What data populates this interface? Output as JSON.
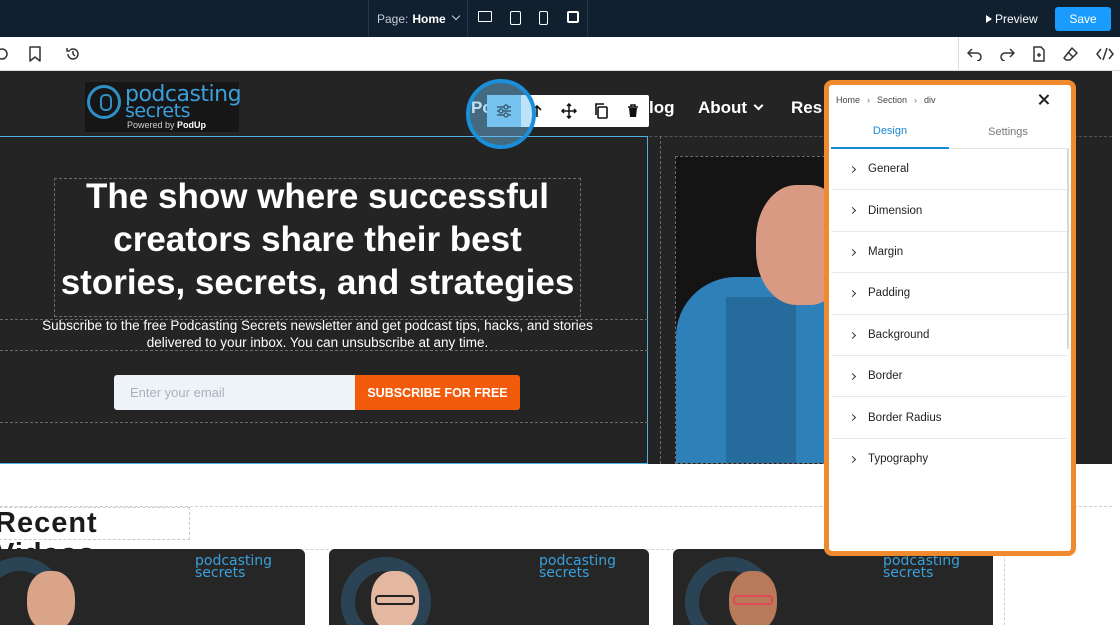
{
  "topbar": {
    "page_label": "Page:",
    "page_value": "Home",
    "preview_label": "Preview",
    "save_label": "Save"
  },
  "hero": {
    "logo": {
      "line1": "podcasting",
      "line2": "secrets",
      "powered_prefix": "Powered by",
      "powered_brand": "PodUp"
    },
    "nav": {
      "partial_left": "Po",
      "blog": "log",
      "about": "About",
      "resources_partial": "Res"
    },
    "headline": "The show where successful creators share their best stories, secrets, and strategies",
    "subtext": "Subscribe to the free Podcasting Secrets newsletter and get podcast tips, hacks, and stories delivered to your inbox. You can unsubscribe at any time.",
    "email_placeholder": "Enter your email",
    "subscribe_label": "SUBSCRIBE FOR FREE"
  },
  "recent": {
    "title": "Recent Videos",
    "card_logo_line1": "podcasting",
    "card_logo_line2": "secrets"
  },
  "panel": {
    "breadcrumb": [
      "Home",
      "Section",
      "div"
    ],
    "tabs": [
      "Design",
      "Settings"
    ],
    "properties": [
      "General",
      "Dimension",
      "Margin",
      "Padding",
      "Background",
      "Border",
      "Border Radius",
      "Typography"
    ]
  },
  "colors": {
    "accent_blue": "#1a9bff",
    "subscribe_orange": "#f35b0c",
    "panel_highlight": "#f08a2e",
    "topbar_bg": "#11202e"
  },
  "icons": {
    "toolbar_left": [
      "bookmark-icon",
      "history-icon"
    ],
    "toolbar_right": [
      "undo-icon",
      "redo-icon",
      "export-icon",
      "eraser-icon",
      "code-icon"
    ],
    "element_toolbar": [
      "settings-sliders-icon",
      "arrow-up-icon",
      "move-icon",
      "duplicate-icon",
      "trash-icon"
    ]
  }
}
